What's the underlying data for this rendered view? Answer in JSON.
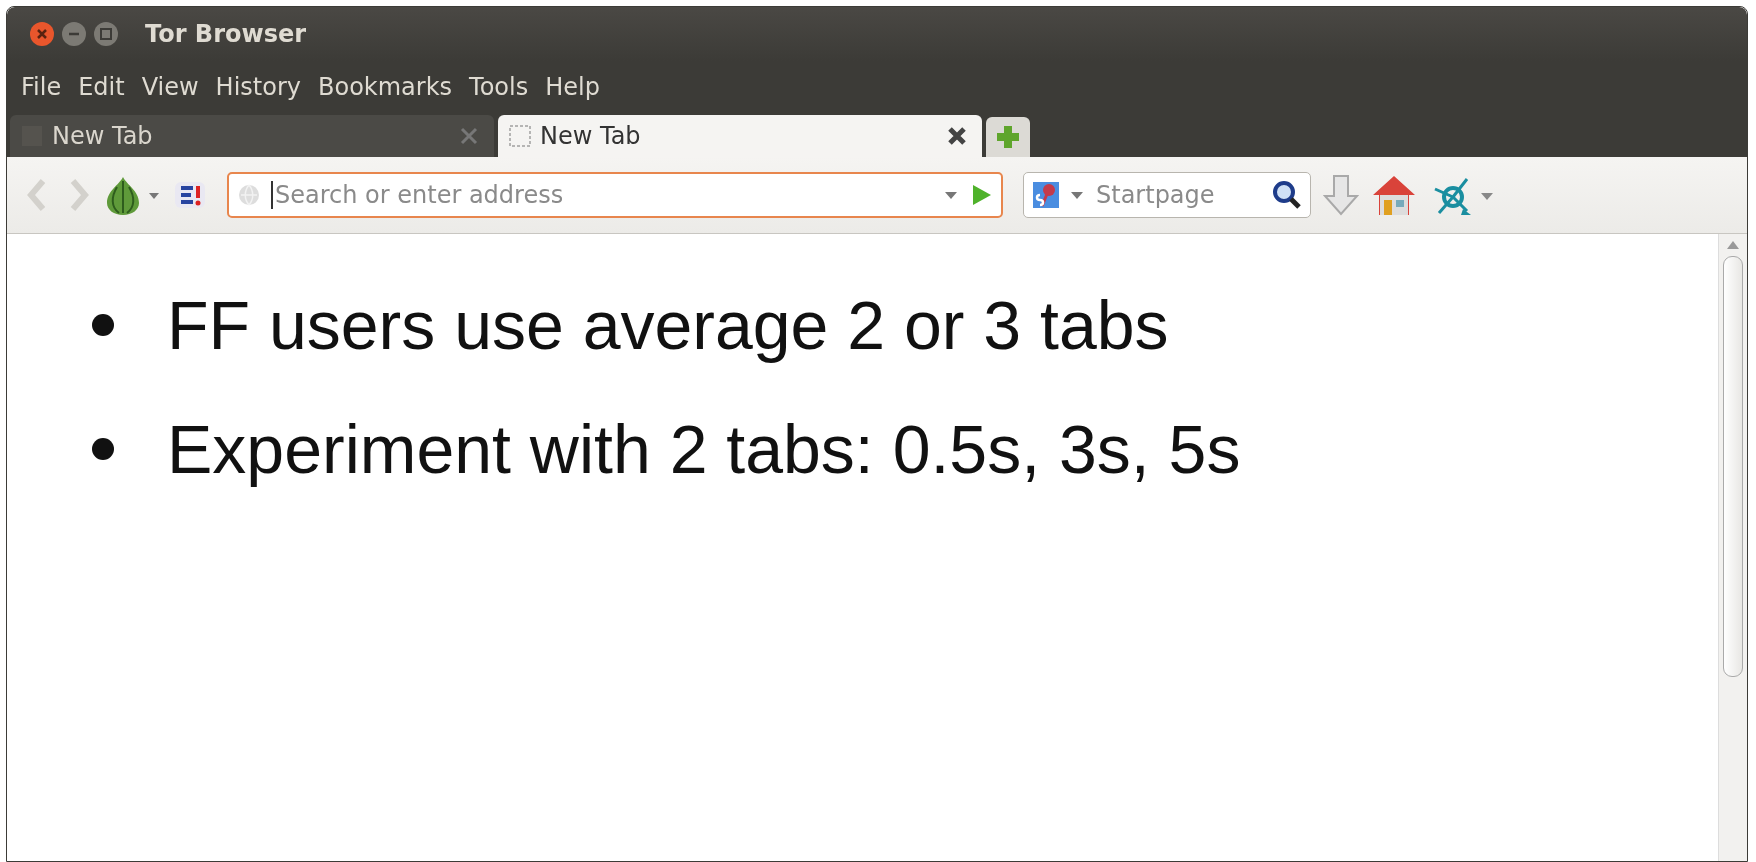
{
  "window": {
    "title": "Tor Browser"
  },
  "menu": [
    "File",
    "Edit",
    "View",
    "History",
    "Bookmarks",
    "Tools",
    "Help"
  ],
  "tabs": [
    {
      "label": "New Tab",
      "selected": false
    },
    {
      "label": "New Tab",
      "selected": true
    }
  ],
  "address_bar": {
    "placeholder": "Search or enter address"
  },
  "search_bar": {
    "placeholder": "Startpage"
  },
  "content": {
    "bullets": [
      "FF users use average 2 or 3 tabs",
      "Experiment with 2 tabs: 0.5s, 3s, 5s"
    ]
  }
}
